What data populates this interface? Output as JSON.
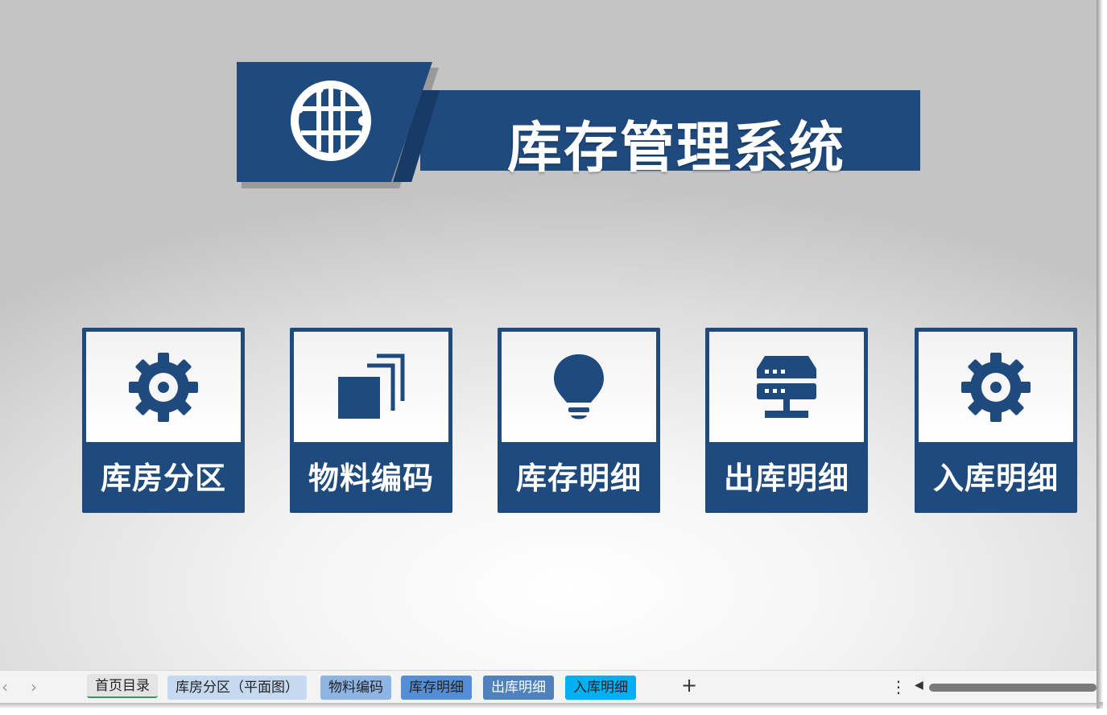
{
  "header": {
    "title": "库存管理系统",
    "icon": "globe-network-icon"
  },
  "cards": [
    {
      "label": "库房分区",
      "icon": "gear-icon"
    },
    {
      "label": "物料编码",
      "icon": "stacked-squares-icon"
    },
    {
      "label": "库存明细",
      "icon": "lightbulb-icon"
    },
    {
      "label": "出库明细",
      "icon": "server-icon"
    },
    {
      "label": "入库明细",
      "icon": "gear-icon"
    }
  ],
  "sheet_tabs": [
    {
      "label": "首页目录",
      "active": true,
      "color": "#e4e4e4"
    },
    {
      "label": "库房分区（平面图）",
      "color": "#c5d9f1"
    },
    {
      "label": "物料编码",
      "color": "#8db4e2"
    },
    {
      "label": "库存明细",
      "color": "#558ed5"
    },
    {
      "label": "出库明细",
      "color": "#4f81bd"
    },
    {
      "label": "入库明细",
      "color": "#00b0f0"
    }
  ],
  "tabbar": {
    "prev": "‹",
    "next": "›",
    "add": "+",
    "more": "⋮",
    "scroll_left": "◀"
  },
  "colors": {
    "brand": "#1f4a7e",
    "active_tab_underline": "#2a9d5a"
  }
}
